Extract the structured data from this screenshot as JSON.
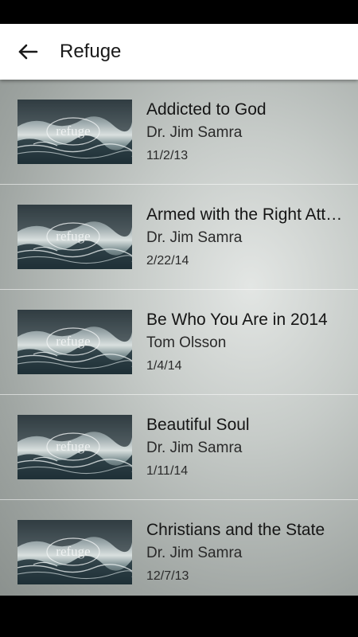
{
  "app_bar": {
    "title": "Refuge",
    "back_icon": "arrow-left-icon"
  },
  "sermons": [
    {
      "title": "Addicted to God",
      "speaker": "Dr. Jim Samra",
      "date": "11/2/13",
      "thumbnail_text": "refuge"
    },
    {
      "title": "Armed with the Right Attitude",
      "speaker": "Dr. Jim Samra",
      "date": "2/22/14",
      "thumbnail_text": "refuge"
    },
    {
      "title": "Be Who You Are in 2014",
      "speaker": "Tom Olsson",
      "date": "1/4/14",
      "thumbnail_text": "refuge"
    },
    {
      "title": "Beautiful Soul",
      "speaker": "Dr. Jim Samra",
      "date": "1/11/14",
      "thumbnail_text": "refuge"
    },
    {
      "title": "Christians and the State",
      "speaker": "Dr. Jim Samra",
      "date": "12/7/13",
      "thumbnail_text": "refuge"
    }
  ]
}
